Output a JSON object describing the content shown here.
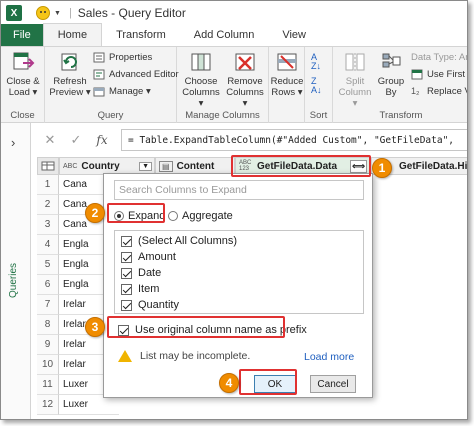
{
  "window": {
    "app_icon": "X",
    "title": "Sales - Query Editor"
  },
  "tabs": [
    "File",
    "Home",
    "Transform",
    "Add Column",
    "View"
  ],
  "ribbon": {
    "close": {
      "button": "Close &\nLoad ▾",
      "group": "Close"
    },
    "query": {
      "refresh": "Refresh\nPreview ▾",
      "properties": "Properties",
      "advanced_editor": "Advanced Editor",
      "manage": "Manage ▾",
      "group": "Query"
    },
    "manage_columns": {
      "choose": "Choose\nColumns ▾",
      "remove": "Remove\nColumns ▾",
      "group": "Manage Columns"
    },
    "reduce": {
      "button": "Reduce\nRows ▾"
    },
    "sort": {
      "group": "Sort"
    },
    "transform": {
      "split": "Split\nColumn ▾",
      "groupby": "Group\nBy",
      "data_type": "Data Type: Any",
      "use_first": "Use First R",
      "replace": "Replace Va",
      "group": "Transform"
    }
  },
  "left_panel": {
    "label": "Queries"
  },
  "formula_bar": {
    "cancel": "✕",
    "confirm": "✓",
    "fx": "fx",
    "formula": "= Table.ExpandTableColumn(#\"Added Custom\", \"GetFileData\","
  },
  "grid": {
    "headers": {
      "country_type": "ABC",
      "country": "Country",
      "content": "Content",
      "getfile": "GetFileData.Data",
      "getfile_type": "ABC 123",
      "hidden": "GetFileData.Hidde"
    },
    "rows": [
      {
        "n": "1",
        "country": "Cana"
      },
      {
        "n": "2",
        "country": "Cana"
      },
      {
        "n": "3",
        "country": "Cana"
      },
      {
        "n": "4",
        "country": "Engla"
      },
      {
        "n": "5",
        "country": "Engla"
      },
      {
        "n": "6",
        "country": "Engla"
      },
      {
        "n": "7",
        "country": "Irelar"
      },
      {
        "n": "8",
        "country": "Irelar"
      },
      {
        "n": "9",
        "country": "Irelar"
      },
      {
        "n": "10",
        "country": "Irelar"
      },
      {
        "n": "11",
        "country": "Luxer"
      },
      {
        "n": "12",
        "country": "Luxer"
      }
    ]
  },
  "popup": {
    "search_placeholder": "Search Columns to Expand",
    "expand": "Expand",
    "aggregate": "Aggregate",
    "columns": [
      "(Select All Columns)",
      "Amount",
      "Date",
      "Item",
      "Quantity"
    ],
    "use_prefix": "Use original column name as prefix",
    "warning": "List may be incomplete.",
    "load_more": "Load more",
    "ok": "OK",
    "cancel": "Cancel"
  },
  "annotations": [
    "1",
    "2",
    "3",
    "4"
  ],
  "colors": {
    "excel_green": "#217346",
    "highlight_red": "#e03131",
    "badge_orange": "#f08c00",
    "link_blue": "#1f5fbf"
  }
}
